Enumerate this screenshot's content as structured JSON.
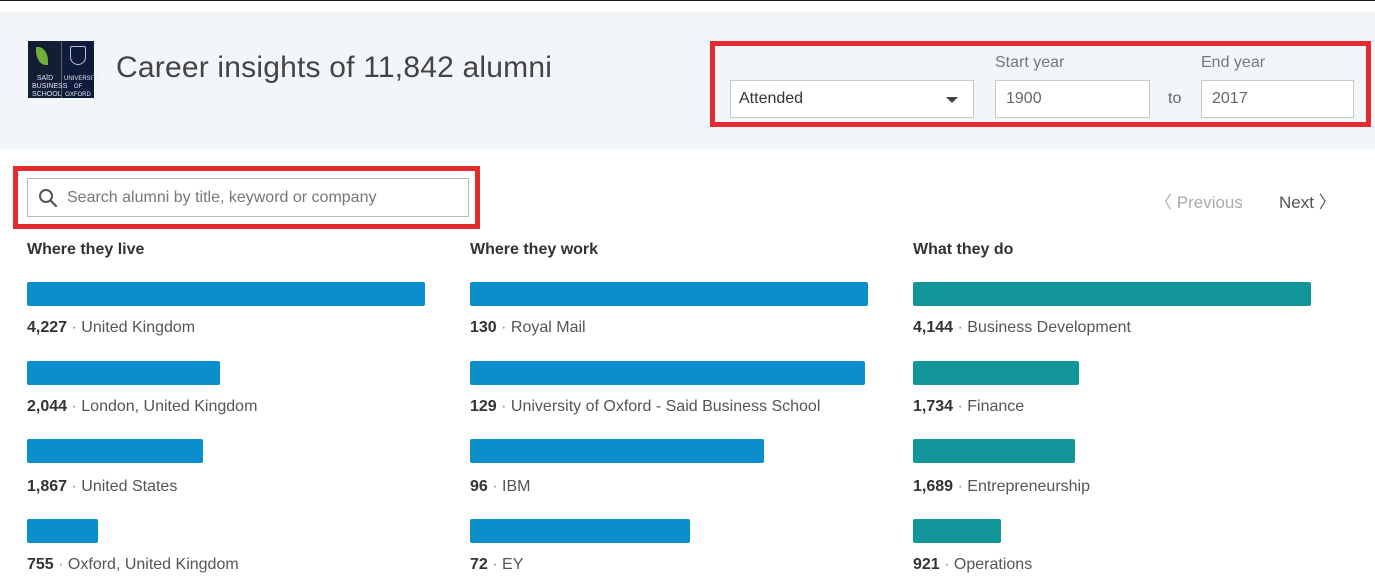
{
  "header": {
    "title": "Career insights of 11,842 alumni",
    "logo_left_text": "SAÏD BUSINESS SCHOOL",
    "logo_right_text": "UNIVERSITY OF OXFORD"
  },
  "filters": {
    "attendance_selected": "Attended",
    "start_label": "Start year",
    "end_label": "End year",
    "start_value": "1900",
    "end_value": "2017",
    "to_label": "to"
  },
  "search": {
    "placeholder": "Search alumni by title, keyword or company",
    "icon": "search-icon"
  },
  "pagination": {
    "previous": "Previous",
    "next": "Next"
  },
  "colors": {
    "blue_bar": "#0a8fcc",
    "teal_bar": "#13969a",
    "highlight": "#e22a2f"
  },
  "columns": [
    {
      "title": "Where they live",
      "rows": [
        {
          "count": "4,227",
          "label": "United Kingdom",
          "ratio": 1.0
        },
        {
          "count": "2,044",
          "label": "London, United Kingdom",
          "ratio": 0.484
        },
        {
          "count": "1,867",
          "label": "United States",
          "ratio": 0.442
        },
        {
          "count": "755",
          "label": "Oxford, United Kingdom",
          "ratio": 0.179
        }
      ]
    },
    {
      "title": "Where they work",
      "rows": [
        {
          "count": "130",
          "label": "Royal Mail",
          "ratio": 1.0
        },
        {
          "count": "129",
          "label": "University of Oxford - Said Business School",
          "ratio": 0.992
        },
        {
          "count": "96",
          "label": "IBM",
          "ratio": 0.738
        },
        {
          "count": "72",
          "label": "EY",
          "ratio": 0.554
        }
      ]
    },
    {
      "title": "What they do",
      "rows": [
        {
          "count": "4,144",
          "label": "Business Development",
          "ratio": 1.0
        },
        {
          "count": "1,734",
          "label": "Finance",
          "ratio": 0.418
        },
        {
          "count": "1,689",
          "label": "Entrepreneurship",
          "ratio": 0.408
        },
        {
          "count": "921",
          "label": "Operations",
          "ratio": 0.222
        }
      ]
    }
  ]
}
